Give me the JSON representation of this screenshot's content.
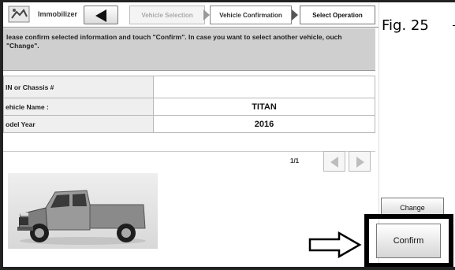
{
  "toolbar": {
    "app_label": "Immobilizer",
    "icons": {
      "app": "immobilizer-app-icon",
      "back": "back-arrow-icon"
    },
    "breadcrumbs": [
      {
        "label": "Vehicle Selection",
        "state": "inactive"
      },
      {
        "label": "Vehicle Confirmation",
        "state": "active"
      },
      {
        "label": "Select Operation",
        "state": "next"
      }
    ]
  },
  "figure_label": "Fig. 25",
  "message": {
    "text": "lease confirm selected information and touch \"Confirm\". In case you want to select another vehicle, ouch \"Change\"."
  },
  "vehicle_info": {
    "rows": [
      {
        "label": "IN or Chassis #",
        "value": ""
      },
      {
        "label": "ehicle Name :",
        "value": "TITAN"
      },
      {
        "label": "odel Year",
        "value": "2016"
      }
    ]
  },
  "pagination": {
    "page_text": "1/1",
    "icons": {
      "prev": "chevron-left-icon",
      "next": "chevron-right-icon"
    }
  },
  "vehicle_image": {
    "icon": "pickup-truck-icon"
  },
  "buttons": {
    "change_label": "Change",
    "confirm_label": "Confirm"
  },
  "annotation": {
    "icon": "arrow-right-pointer-icon"
  },
  "colors": {
    "message_bg": "#cfcfcf",
    "label_cell_bg": "#efefef",
    "highlight_border": "#000000",
    "truck_body": "#8a8a8a"
  }
}
